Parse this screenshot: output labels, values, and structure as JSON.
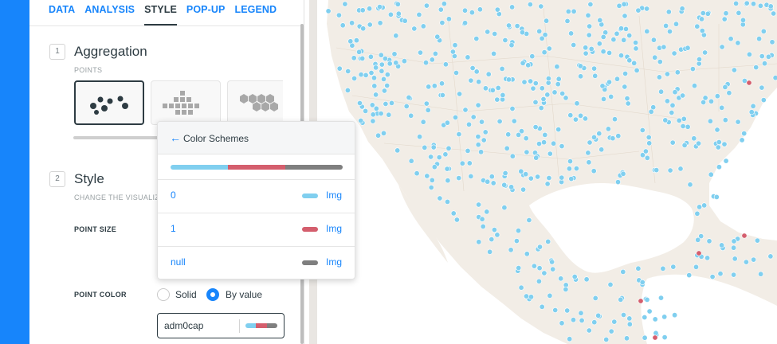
{
  "tabs": [
    "DATA",
    "ANALYSIS",
    "STYLE",
    "POP-UP",
    "LEGEND"
  ],
  "active_tab": "STYLE",
  "sections": {
    "aggregation": {
      "number": "1",
      "title": "Aggregation",
      "subtitle": "POINTS"
    },
    "style": {
      "number": "2",
      "title": "Style",
      "subtitle": "CHANGE THE VISUALIZ"
    }
  },
  "fields": {
    "point_size_label": "POINT SIZE",
    "point_color_label": "POINT COLOR",
    "color_options": [
      "Solid",
      "By value"
    ],
    "selected_color_option": "By value",
    "value_field": "adm0cap"
  },
  "popup": {
    "back_icon": "arrow-left-icon",
    "title": "Color Schemes",
    "rows": [
      {
        "value": "0",
        "color": "#80cfef",
        "action": "Img"
      },
      {
        "value": "1",
        "color": "#d45e6d",
        "action": "Img"
      },
      {
        "value": "null",
        "color": "#7f7f7f",
        "action": "Img"
      }
    ]
  },
  "colors": {
    "accent": "#1785fb",
    "point_default": "#80cfef",
    "point_capital": "#d45e6d",
    "point_null": "#7f7f7f"
  }
}
